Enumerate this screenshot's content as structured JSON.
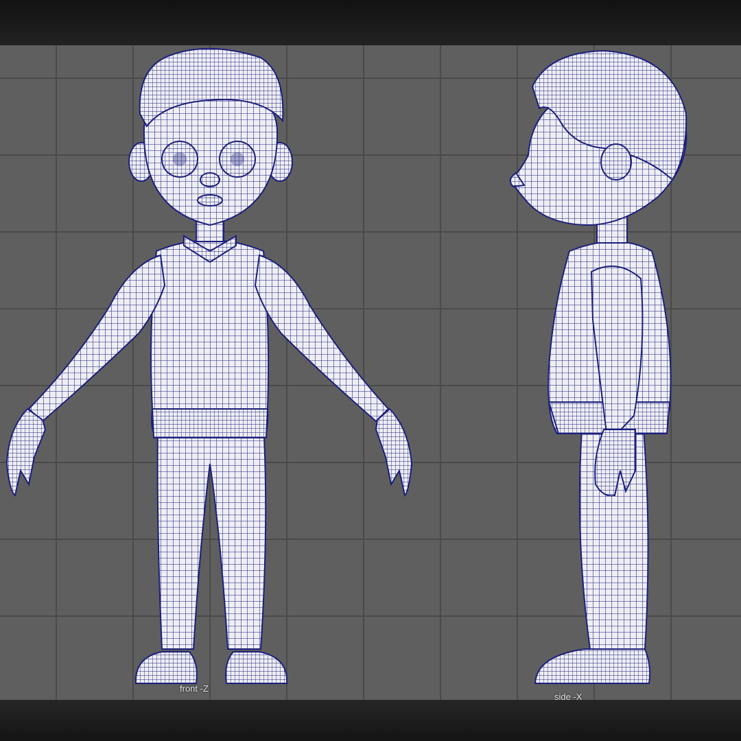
{
  "viewports": {
    "front": {
      "label": "front -Z"
    },
    "side": {
      "label": "side -X"
    }
  },
  "colors": {
    "background": "#5f5f5f",
    "grid": "#4a4a4a",
    "mesh_fill": "#eeeef4",
    "wireframe": "#1c1f7a"
  }
}
